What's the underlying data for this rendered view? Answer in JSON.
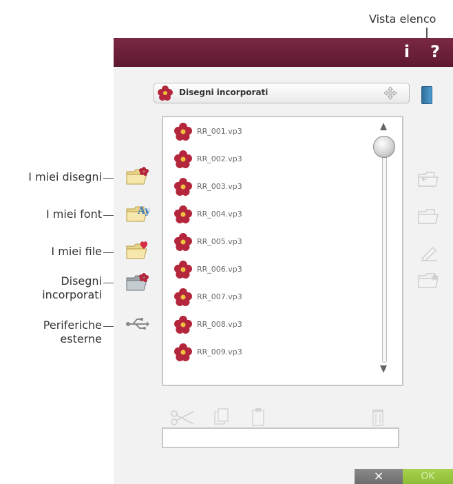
{
  "callouts": {
    "list_view": "Vista elenco",
    "my_designs": "I miei disegni",
    "my_fonts": "I miei font",
    "my_files": "I miei file",
    "builtin_designs": [
      "Disegni",
      "incorporati"
    ],
    "external_devices": [
      "Periferiche",
      "esterne"
    ]
  },
  "topbar": {
    "info_label": "i",
    "help_label": "?",
    "color": "#6a1f39"
  },
  "folder_dropdown": {
    "selected": "Disegni incorporati"
  },
  "file_list": {
    "items": [
      "RR_001.vp3",
      "RR_002.vp3",
      "RR_003.vp3",
      "RR_004.vp3",
      "RR_005.vp3",
      "RR_006.vp3",
      "RR_007.vp3",
      "RR_008.vp3",
      "RR_009.vp3"
    ]
  },
  "file_name_field": {
    "value": ""
  },
  "buttons": {
    "cancel": "×",
    "ok": "OK"
  }
}
